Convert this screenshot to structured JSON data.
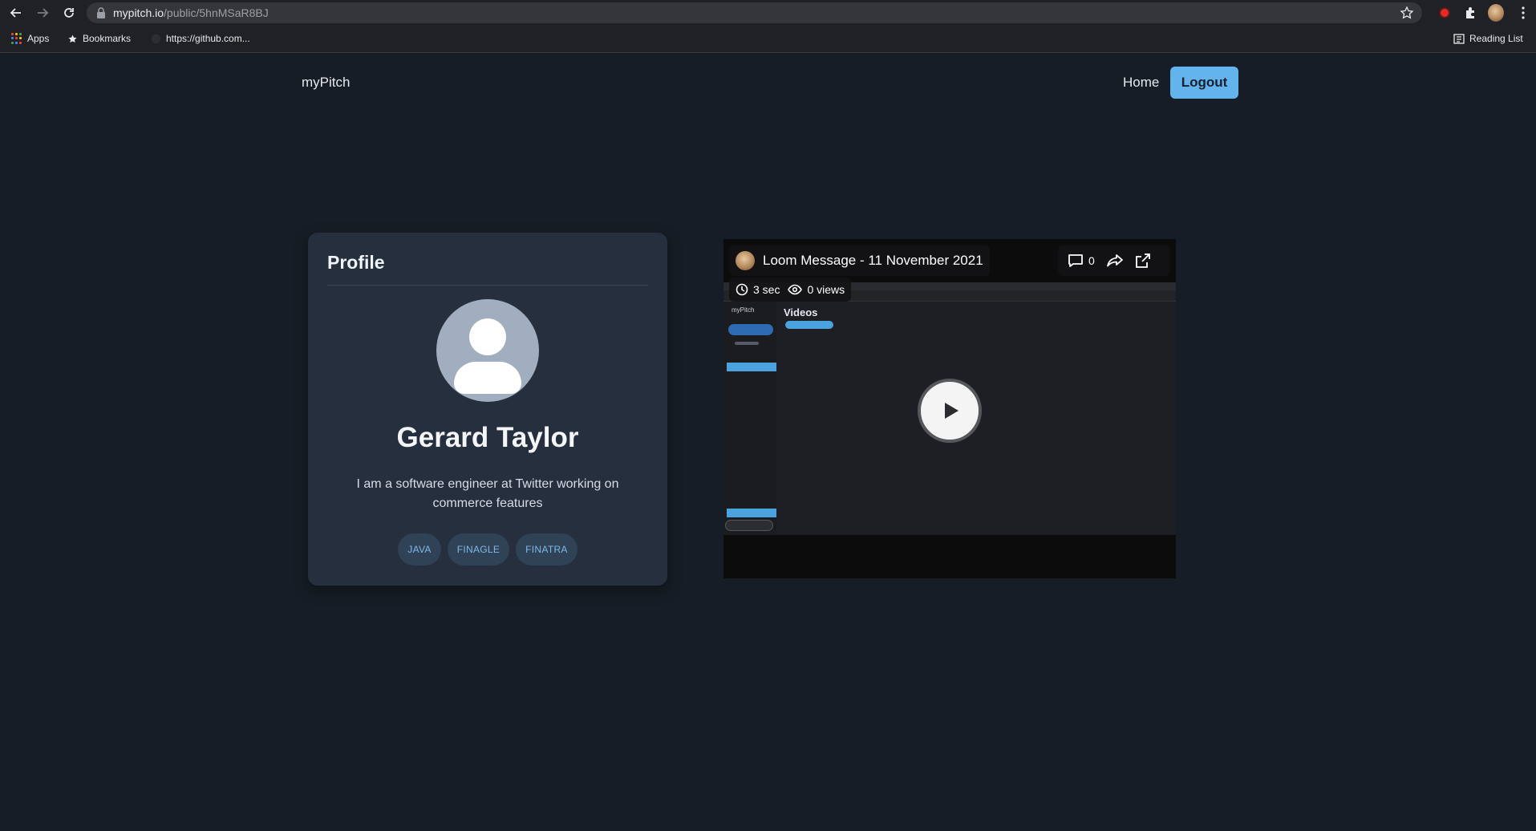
{
  "browser": {
    "url_domain": "mypitch.io",
    "url_path": "/public/5hnMSaR8BJ",
    "bookmarks": [
      "Apps",
      "Bookmarks",
      "https://github.com..."
    ],
    "reading_list": "Reading List"
  },
  "header": {
    "brand": "myPitch",
    "home": "Home",
    "logout": "Logout"
  },
  "profile": {
    "title": "Profile",
    "name": "Gerard Taylor",
    "bio": "I am a software engineer at Twitter working on commerce features",
    "tags": [
      "JAVA",
      "FINAGLE",
      "FINATRA"
    ]
  },
  "video": {
    "title": "Loom Message - 11 November 2021",
    "comments": "0",
    "duration": "3 sec",
    "views": "0 views",
    "preview_brand": "myPitch",
    "preview_heading": "Videos"
  },
  "colors": {
    "page_bg": "#171d26",
    "card_bg": "#252f3e",
    "accent": "#63b3ed",
    "tag_text": "#7fb9e8"
  }
}
